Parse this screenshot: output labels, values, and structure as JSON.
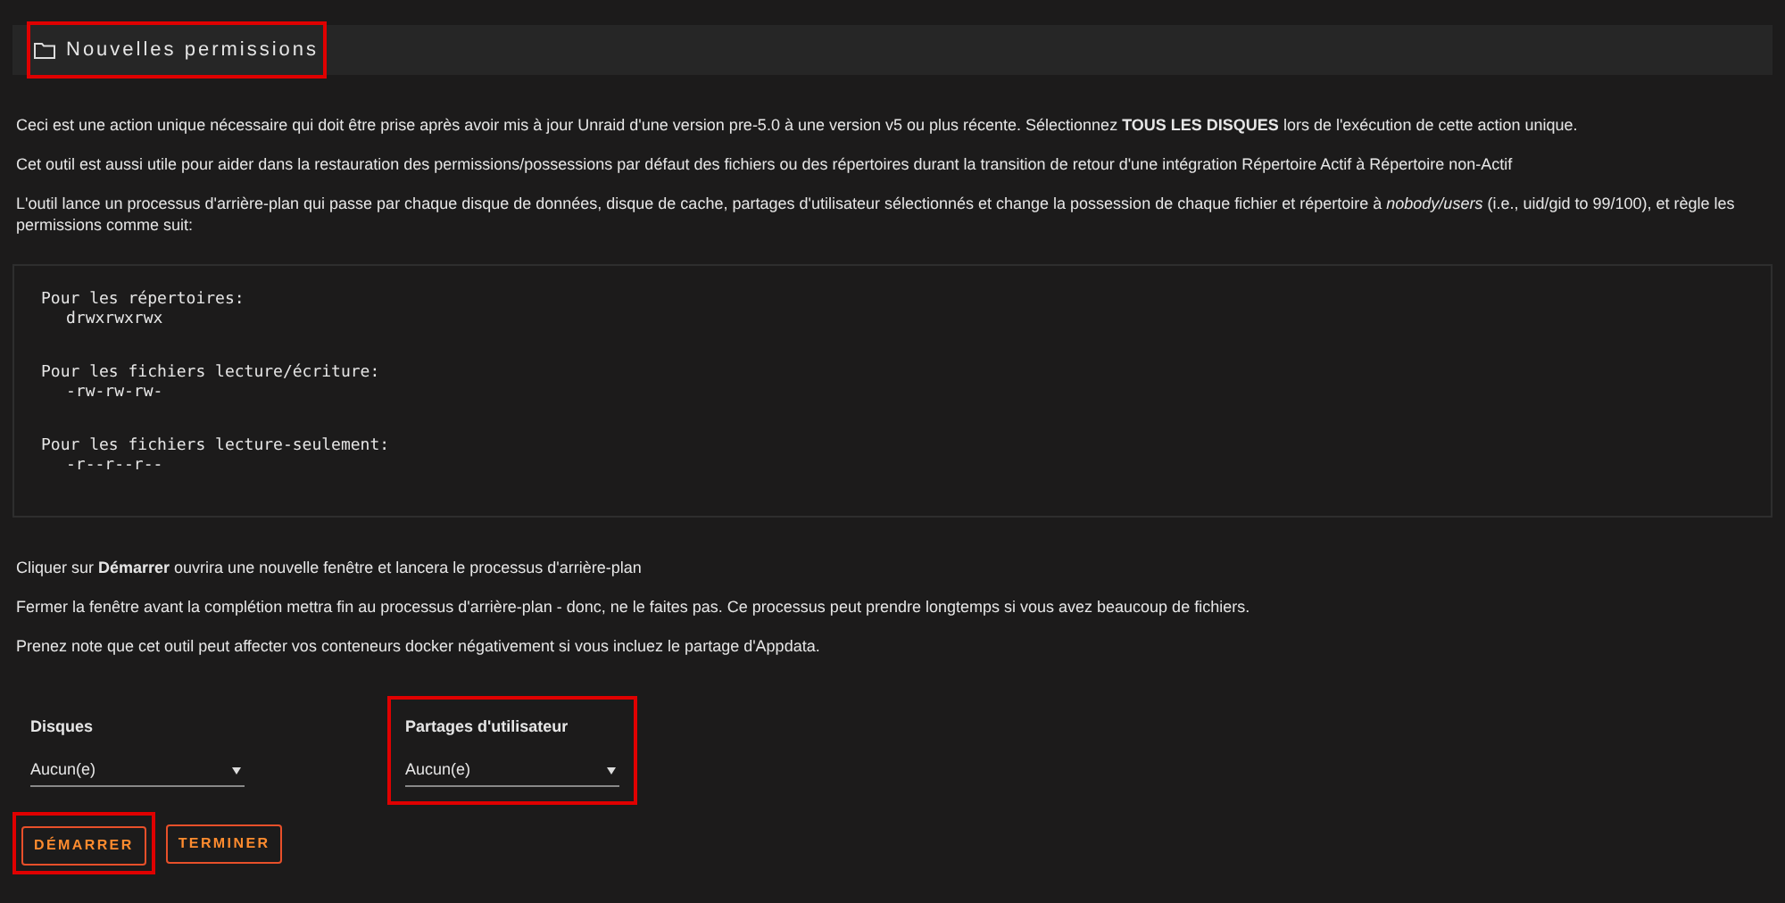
{
  "header": {
    "title": "Nouvelles permissions",
    "highlighted": true
  },
  "intro": [
    "Ceci est une action unique nécessaire qui doit être prise après avoir mis à jour Unraid d'une version pre-5.0 à une version v5 ou plus récente. Sélectionnez **TOUS LES DISQUES** lors de l'exécution de cette action unique.",
    "Cet outil est aussi utile pour aider dans la restauration des permissions/possessions par défaut des fichiers ou des répertoires durant la transition de retour d'une intégration Répertoire Actif à Répertoire non-Actif",
    "L'outil lance un processus d'arrière-plan qui passe par chaque disque de données, disque de cache, partages d'utilisateur sélectionnés et change la possession de chaque fichier et répertoire à *nobody/users* (i.e., uid/gid to 99/100), et règle les permissions comme suit:"
  ],
  "code_block": [
    {
      "label": "Pour les répertoires:",
      "value": "drwxrwxrwx"
    },
    {
      "label": "Pour les fichiers lecture/écriture:",
      "value": "-rw-rw-rw-"
    },
    {
      "label": "Pour les fichiers lecture-seulement:",
      "value": "-r--r--r--"
    }
  ],
  "notes": [
    "Cliquer sur **Démarrer** ouvrira une nouvelle fenêtre et lancera le processus d'arrière-plan",
    "Fermer la fenêtre avant la complétion mettra fin au processus d'arrière-plan - donc, ne le faites pas. Ce processus peut prendre longtemps si vous avez beaucoup de fichiers.",
    "Prenez note que cet outil peut affecter vos conteneurs docker négativement si vous incluez le partage d'Appdata."
  ],
  "selects": [
    {
      "label": "Disques",
      "value": "Aucun(e)",
      "highlighted": false
    },
    {
      "label": "Partages d'utilisateur",
      "value": "Aucun(e)",
      "highlighted": true
    }
  ],
  "buttons": [
    {
      "label": "DÉMARRER",
      "highlighted": true
    },
    {
      "label": "TERMINER",
      "highlighted": false
    }
  ]
}
